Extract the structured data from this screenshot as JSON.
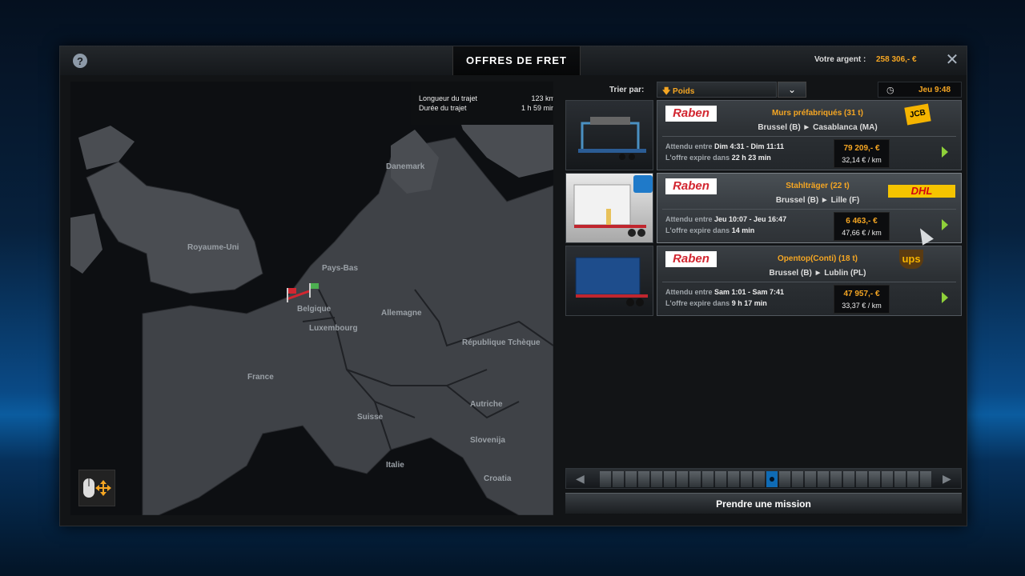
{
  "window": {
    "title": "OFFRES DE FRET",
    "help_icon": "?",
    "money_label": "Votre argent :",
    "money_value": "258 306,- €",
    "close_icon": "✕"
  },
  "map": {
    "route_length_label": "Longueur du trajet",
    "route_length_value": "123 km",
    "route_duration_label": "Durée du trajet",
    "route_duration_value": "1 h 59 min",
    "labels": {
      "danemark": "Danemark",
      "royaume_uni": "Royaume-Uni",
      "pays_bas": "Pays-Bas",
      "belgique": "Belgique",
      "allemagne": "Allemagne",
      "luxembourg": "Luxembourg",
      "republique_tcheque": "République Tchèque",
      "france": "France",
      "suisse": "Suisse",
      "autriche": "Autriche",
      "slovenija": "Slovenija",
      "italie": "Italie",
      "croatia": "Croatia"
    }
  },
  "sort": {
    "label": "Trier par:",
    "selected": "🡇 Poids",
    "dropdown_icon": "⌄"
  },
  "clock": {
    "icon": "◷",
    "value": "Jeu 9:48"
  },
  "jobs": [
    {
      "company": "Raben",
      "cargo": "Murs préfabriqués (31 t)",
      "route": "Brussel (B)  ►  Casablanca (MA)",
      "brand": "JCB",
      "expected_label": "Attendu entre",
      "expected_value": "Dim 4:31 - Dim 11:11",
      "expires_label": "L'offre expire dans",
      "expires_value": "22 h 23 min",
      "price": "79 209,- €",
      "per_km": "32,14 € / km"
    },
    {
      "company": "Raben",
      "cargo": "Stahlträger (22 t)",
      "route": "Brussel (B)  ►  Lille (F)",
      "brand": "DHL",
      "expected_label": "Attendu entre",
      "expected_value": "Jeu 10:07 - Jeu 16:47",
      "expires_label": "L'offre expire dans",
      "expires_value": "14 min",
      "price": "6 463,- €",
      "per_km": "47,66 € / km"
    },
    {
      "company": "Raben",
      "cargo": "Opentop(Conti) (18 t)",
      "route": "Brussel (B)  ►  Lublin (PL)",
      "brand": "ups",
      "expected_label": "Attendu entre",
      "expected_value": "Sam 1:01 - Sam 7:41",
      "expires_label": "L'offre expire dans",
      "expires_value": "9 h 17 min",
      "price": "47 957,- €",
      "per_km": "33,37 € / km"
    }
  ],
  "take_mission": "Prendre une mission",
  "colors": {
    "accent": "#f5a623",
    "go": "#8fd13a",
    "pager_current": "#0f6bb5"
  }
}
